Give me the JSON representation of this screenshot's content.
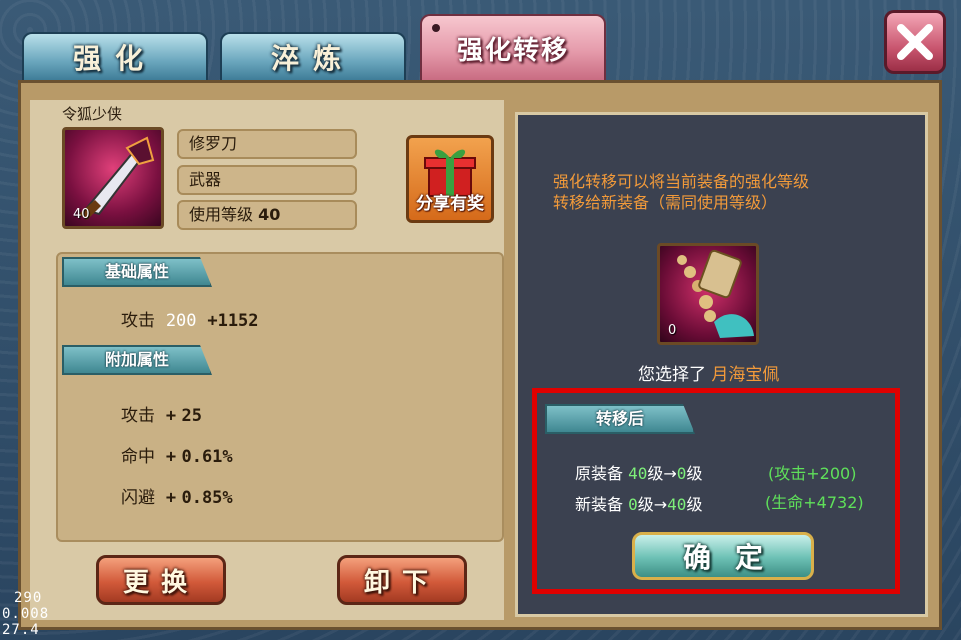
{
  "tabs": [
    {
      "label": "强化",
      "active": false
    },
    {
      "label": "淬炼",
      "active": false
    },
    {
      "label": "强化转移",
      "active": true
    }
  ],
  "close_icon": "close-x-icon",
  "character": {
    "name": "令狐少侠",
    "item_level": "40",
    "item_name": "修罗刀",
    "item_type": "武器",
    "use_level_label": "使用等级",
    "use_level": "40"
  },
  "share_button": {
    "label": "分享有奖",
    "icon": "gift-box-icon"
  },
  "base_attrs": {
    "title": "基础属性",
    "rows": [
      {
        "name": "攻击",
        "value": "200",
        "bonus": "+1152"
      }
    ]
  },
  "extra_attrs": {
    "title": "附加属性",
    "rows": [
      {
        "name": "攻击",
        "sign": "+",
        "value": "25"
      },
      {
        "name": "命中",
        "sign": "+",
        "value": "0.61%"
      },
      {
        "name": "闪避",
        "sign": "+",
        "value": "0.85%"
      }
    ]
  },
  "buttons": {
    "replace": "更换",
    "unequip": "卸下",
    "confirm": "确定"
  },
  "transfer": {
    "desc_line1": "强化转移可以将当前装备的强化等级",
    "desc_line2": "转移给新装备（需同使用等级）",
    "target_level": "0",
    "selected_prefix": "您选择了",
    "selected_item": "月海宝佩",
    "after_title": "转移后",
    "orig_label": "原装备",
    "orig_from": "40",
    "orig_to": "0",
    "orig_bonus": "(攻击+200)",
    "new_label": "新装备",
    "new_from": "0",
    "new_to": "40",
    "new_bonus": "(生命+4732)",
    "level_unit": "级",
    "arrow": "→"
  },
  "debug": {
    "line1": "290",
    "line2": "0.008",
    "line3": "27.4"
  },
  "colors": {
    "accent_orange": "#f29a3a",
    "green": "#5fe05a",
    "highlight_red": "#e00000"
  }
}
